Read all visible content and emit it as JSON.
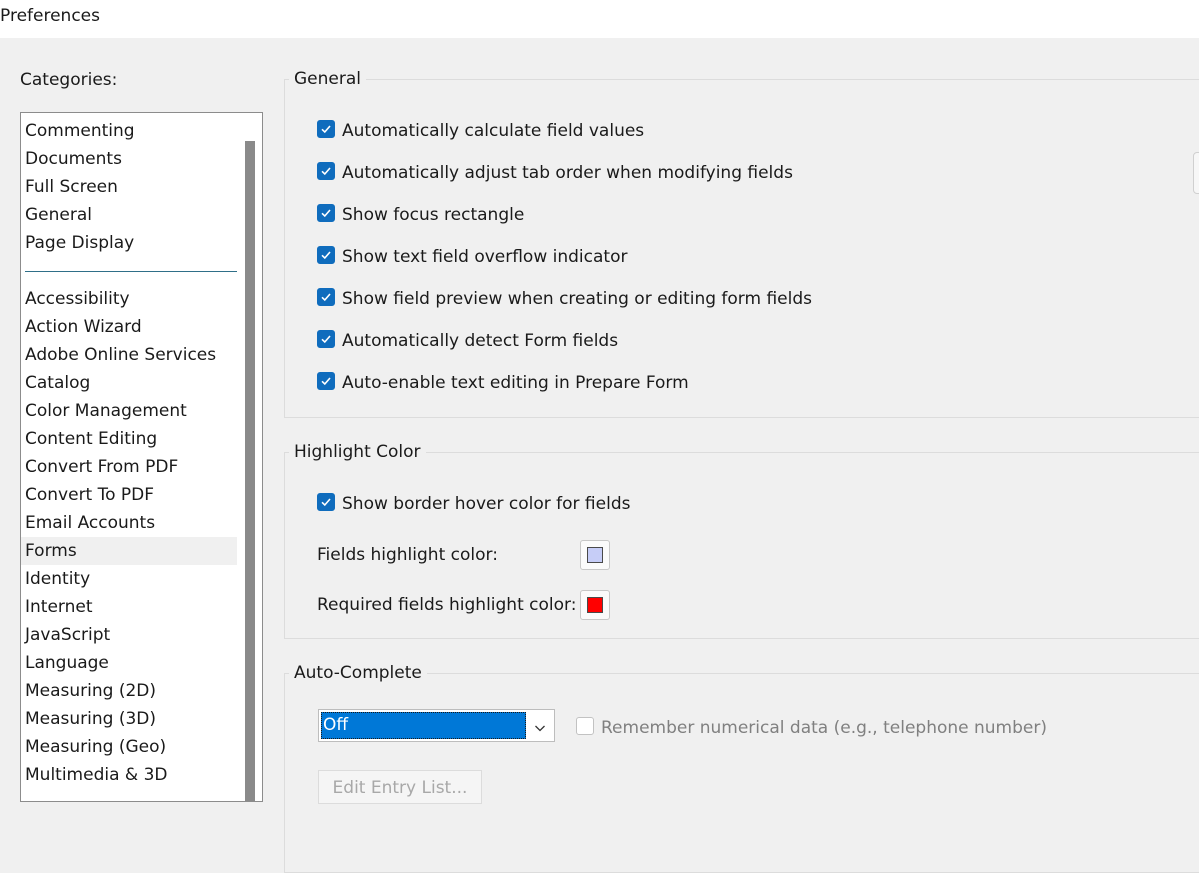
{
  "window": {
    "title": "Preferences"
  },
  "categories": {
    "label": "Categories:",
    "top_items": [
      "Commenting",
      "Documents",
      "Full Screen",
      "General",
      "Page Display"
    ],
    "items": [
      "Accessibility",
      "Action Wizard",
      "Adobe Online Services",
      "Catalog",
      "Color Management",
      "Content Editing",
      "Convert From PDF",
      "Convert To PDF",
      "Email Accounts",
      "Forms",
      "Identity",
      "Internet",
      "JavaScript",
      "Language",
      "Measuring (2D)",
      "Measuring (3D)",
      "Measuring (Geo)",
      "Multimedia & 3D"
    ],
    "selected": "Forms"
  },
  "general": {
    "title": "General",
    "options": [
      {
        "label": "Automatically calculate field values",
        "checked": true
      },
      {
        "label": "Automatically adjust tab order when modifying fields",
        "checked": true
      },
      {
        "label": "Show focus rectangle",
        "checked": true
      },
      {
        "label": "Show text field overflow indicator",
        "checked": true
      },
      {
        "label": "Show field preview when creating or editing form fields",
        "checked": true
      },
      {
        "label": "Automatically detect Form fields",
        "checked": true
      },
      {
        "label": "Auto-enable text editing in Prepare Form",
        "checked": true
      }
    ]
  },
  "highlight": {
    "title": "Highlight Color",
    "show_border_hover": {
      "label": "Show border hover color for fields",
      "checked": true
    },
    "fields_color": {
      "label": "Fields highlight color:",
      "color": "#c6cdf7"
    },
    "required_color": {
      "label": "Required fields highlight color:",
      "color": "#ff0000"
    }
  },
  "autocomplete": {
    "title": "Auto-Complete",
    "mode": "Off",
    "remember_numeric": {
      "label": "Remember numerical data (e.g., telephone number)",
      "checked": false
    },
    "edit_list_label": "Edit Entry List..."
  },
  "colors": {
    "accent": "#0f6cbd",
    "selection": "#0078d7"
  }
}
